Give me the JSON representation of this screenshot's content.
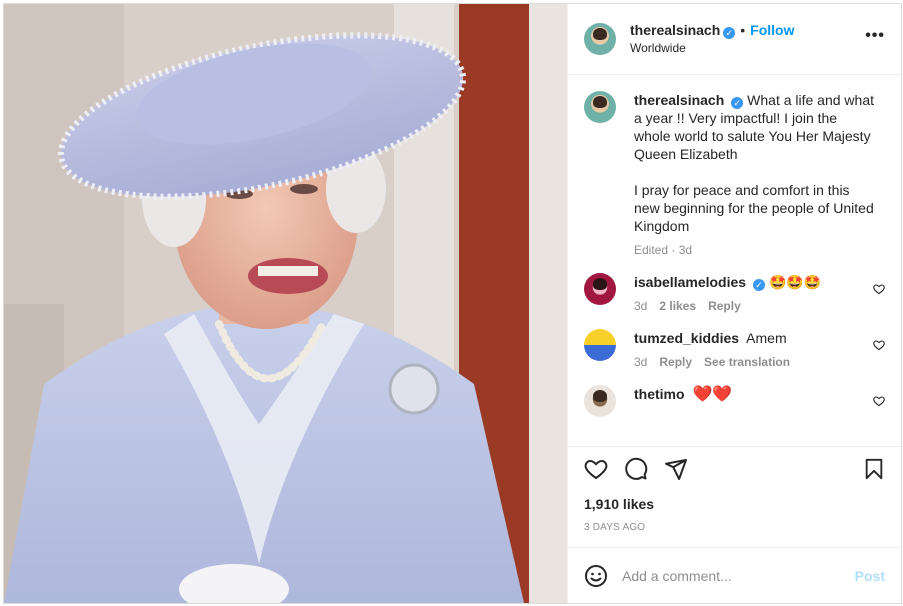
{
  "post": {
    "username": "therealsinach",
    "follow_label": "Follow",
    "dot": "•",
    "location": "Worldwide",
    "more_label": "•••",
    "caption_line1": "What a life and what a year !! Very impactful! I join the whole world to salute You Her Majesty Queen Elizabeth",
    "caption_line2": "I pray for peace and comfort in this new beginning for the people of United Kingdom",
    "caption_meta": "Edited · 3d",
    "likes": "1,910 likes",
    "time_ago": "3 DAYS AGO",
    "comment_placeholder": "Add a comment...",
    "post_label": "Post",
    "verified_mark": "✓"
  },
  "comments": [
    {
      "username": "isabellamelodies",
      "text": "🤩🤩🤩",
      "age": "3d",
      "likes": "2 likes",
      "reply": "Reply",
      "translate": ""
    },
    {
      "username": "tumzed_kiddies",
      "text": "Amem",
      "age": "3d",
      "likes": "",
      "reply": "Reply",
      "translate": "See translation"
    },
    {
      "username": "thetimo",
      "text": "❤️❤️",
      "age": "",
      "likes": "",
      "reply": "",
      "translate": ""
    }
  ],
  "icons": [
    "more-options-icon",
    "verified-icon",
    "heart-icon",
    "comment-icon",
    "share-icon",
    "bookmark-icon",
    "emoji-icon"
  ],
  "colors": {
    "accent": "#0095f6",
    "verified": "#3897f0",
    "muted": "#8e8e8e",
    "post_disabled": "#b2dffc"
  }
}
